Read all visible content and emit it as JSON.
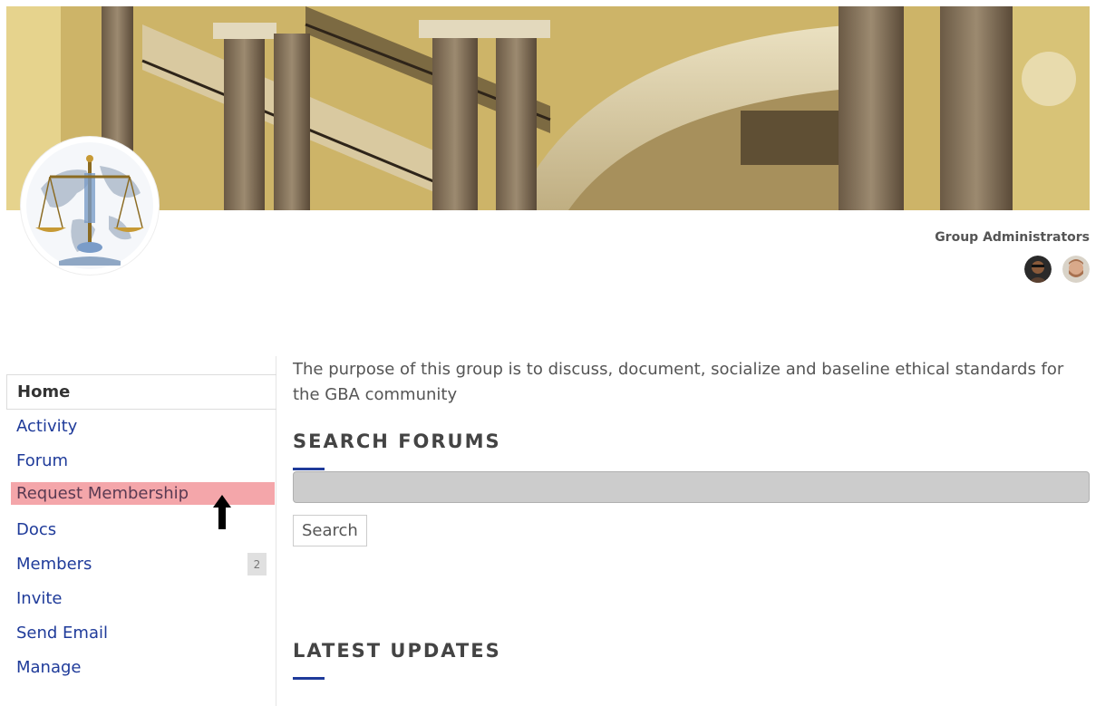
{
  "group": {
    "cover_image": "grand-staircase-cover",
    "avatar_icon": "scales-of-justice-globe-icon",
    "admins_title": "Group Administrators",
    "admins": [
      {
        "icon": "admin-avatar-1"
      },
      {
        "icon": "admin-avatar-2"
      }
    ]
  },
  "nav": {
    "items": [
      {
        "label": "Home",
        "current": true
      },
      {
        "label": "Activity"
      },
      {
        "label": "Forum"
      },
      {
        "label": "Request Membership",
        "highlighted": true
      },
      {
        "label": "Docs"
      },
      {
        "label": "Members",
        "count": "2"
      },
      {
        "label": "Invite"
      },
      {
        "label": "Send Email"
      },
      {
        "label": "Manage"
      }
    ]
  },
  "main": {
    "description": "The purpose of this group is to discuss, document, socialize and baseline ethical standards for the GBA community",
    "search_forums": {
      "title": "SEARCH FORUMS",
      "input_value": "",
      "button_label": "Search"
    },
    "latest_updates": {
      "title": "LATEST UPDATES"
    }
  },
  "colors": {
    "accent": "#1f3b9a",
    "highlight": "#f4a6aa",
    "search_field": "#cccccc"
  }
}
